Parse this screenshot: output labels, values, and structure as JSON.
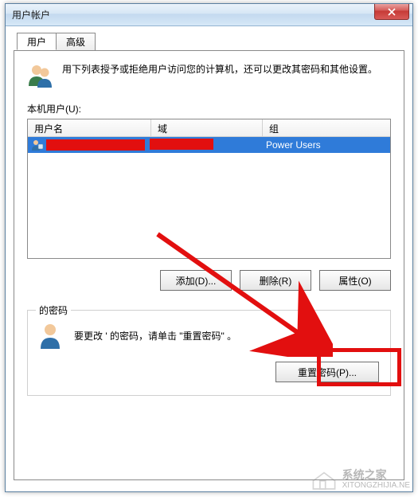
{
  "window": {
    "title": "用户帐户",
    "close_icon": "close"
  },
  "tabs": {
    "user": "用户",
    "advanced": "高级"
  },
  "intro": "用下列表授予或拒绝用户访问您的计算机，还可以更改其密码和其他设置。",
  "users_label": "本机用户(U):",
  "columns": {
    "username": "用户名",
    "domain": "域",
    "group": "组"
  },
  "rows": [
    {
      "username_redacted": true,
      "domain_redacted": true,
      "group": "Power Users"
    }
  ],
  "buttons": {
    "add": "添加(D)...",
    "remove": "删除(R)",
    "properties": "属性(O)"
  },
  "pwd_group": {
    "legend": "的密码",
    "text": "要更改 '   的密码，请单击 \"重置密码\" 。",
    "reset": "重置密码(P)..."
  },
  "watermark": {
    "cn": "系统之家",
    "en": "XITONGZHIJIA.NE"
  }
}
